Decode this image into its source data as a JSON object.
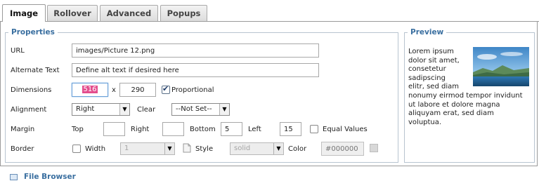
{
  "tabs": [
    {
      "label": "Image",
      "active": true
    },
    {
      "label": "Rollover",
      "active": false
    },
    {
      "label": "Advanced",
      "active": false
    },
    {
      "label": "Popups",
      "active": false
    }
  ],
  "properties": {
    "legend": "Properties",
    "url": {
      "label": "URL",
      "value": "images/Picture 12.png"
    },
    "alt": {
      "label": "Alternate Text",
      "value": "Define alt text if desired here"
    },
    "dimensions": {
      "label": "Dimensions",
      "width": "516",
      "separator": "x",
      "height": "290",
      "proportional_label": "Proportional",
      "proportional_checked": true
    },
    "alignment": {
      "label": "Alignment",
      "value": "Right",
      "clear_label": "Clear",
      "clear_value": "--Not Set--"
    },
    "margin": {
      "label": "Margin",
      "top_label": "Top",
      "top": "",
      "right_label": "Right",
      "right": "",
      "bottom_label": "Bottom",
      "bottom": "5",
      "left_label": "Left",
      "left": "15",
      "equal_label": "Equal Values"
    },
    "border": {
      "label": "Border",
      "width_label": "Width",
      "width_value": "1",
      "style_label": "Style",
      "style_value": "solid",
      "color_label": "Color",
      "color_placeholder": "#000000"
    }
  },
  "preview": {
    "legend": "Preview",
    "text_lines": [
      "Lorem ipsum",
      "dolor sit amet,",
      "consetetur",
      "sadipscing",
      "elitr, sed diam",
      "nonumy eirmod tempor invidunt",
      "ut labore et dolore magna",
      "aliquyam erat, sed diam",
      "voluptua."
    ]
  },
  "footer": {
    "file_browser": "File Browser"
  },
  "colors": {
    "accent": "#3a6fa0",
    "selection": "#e34d8d"
  }
}
